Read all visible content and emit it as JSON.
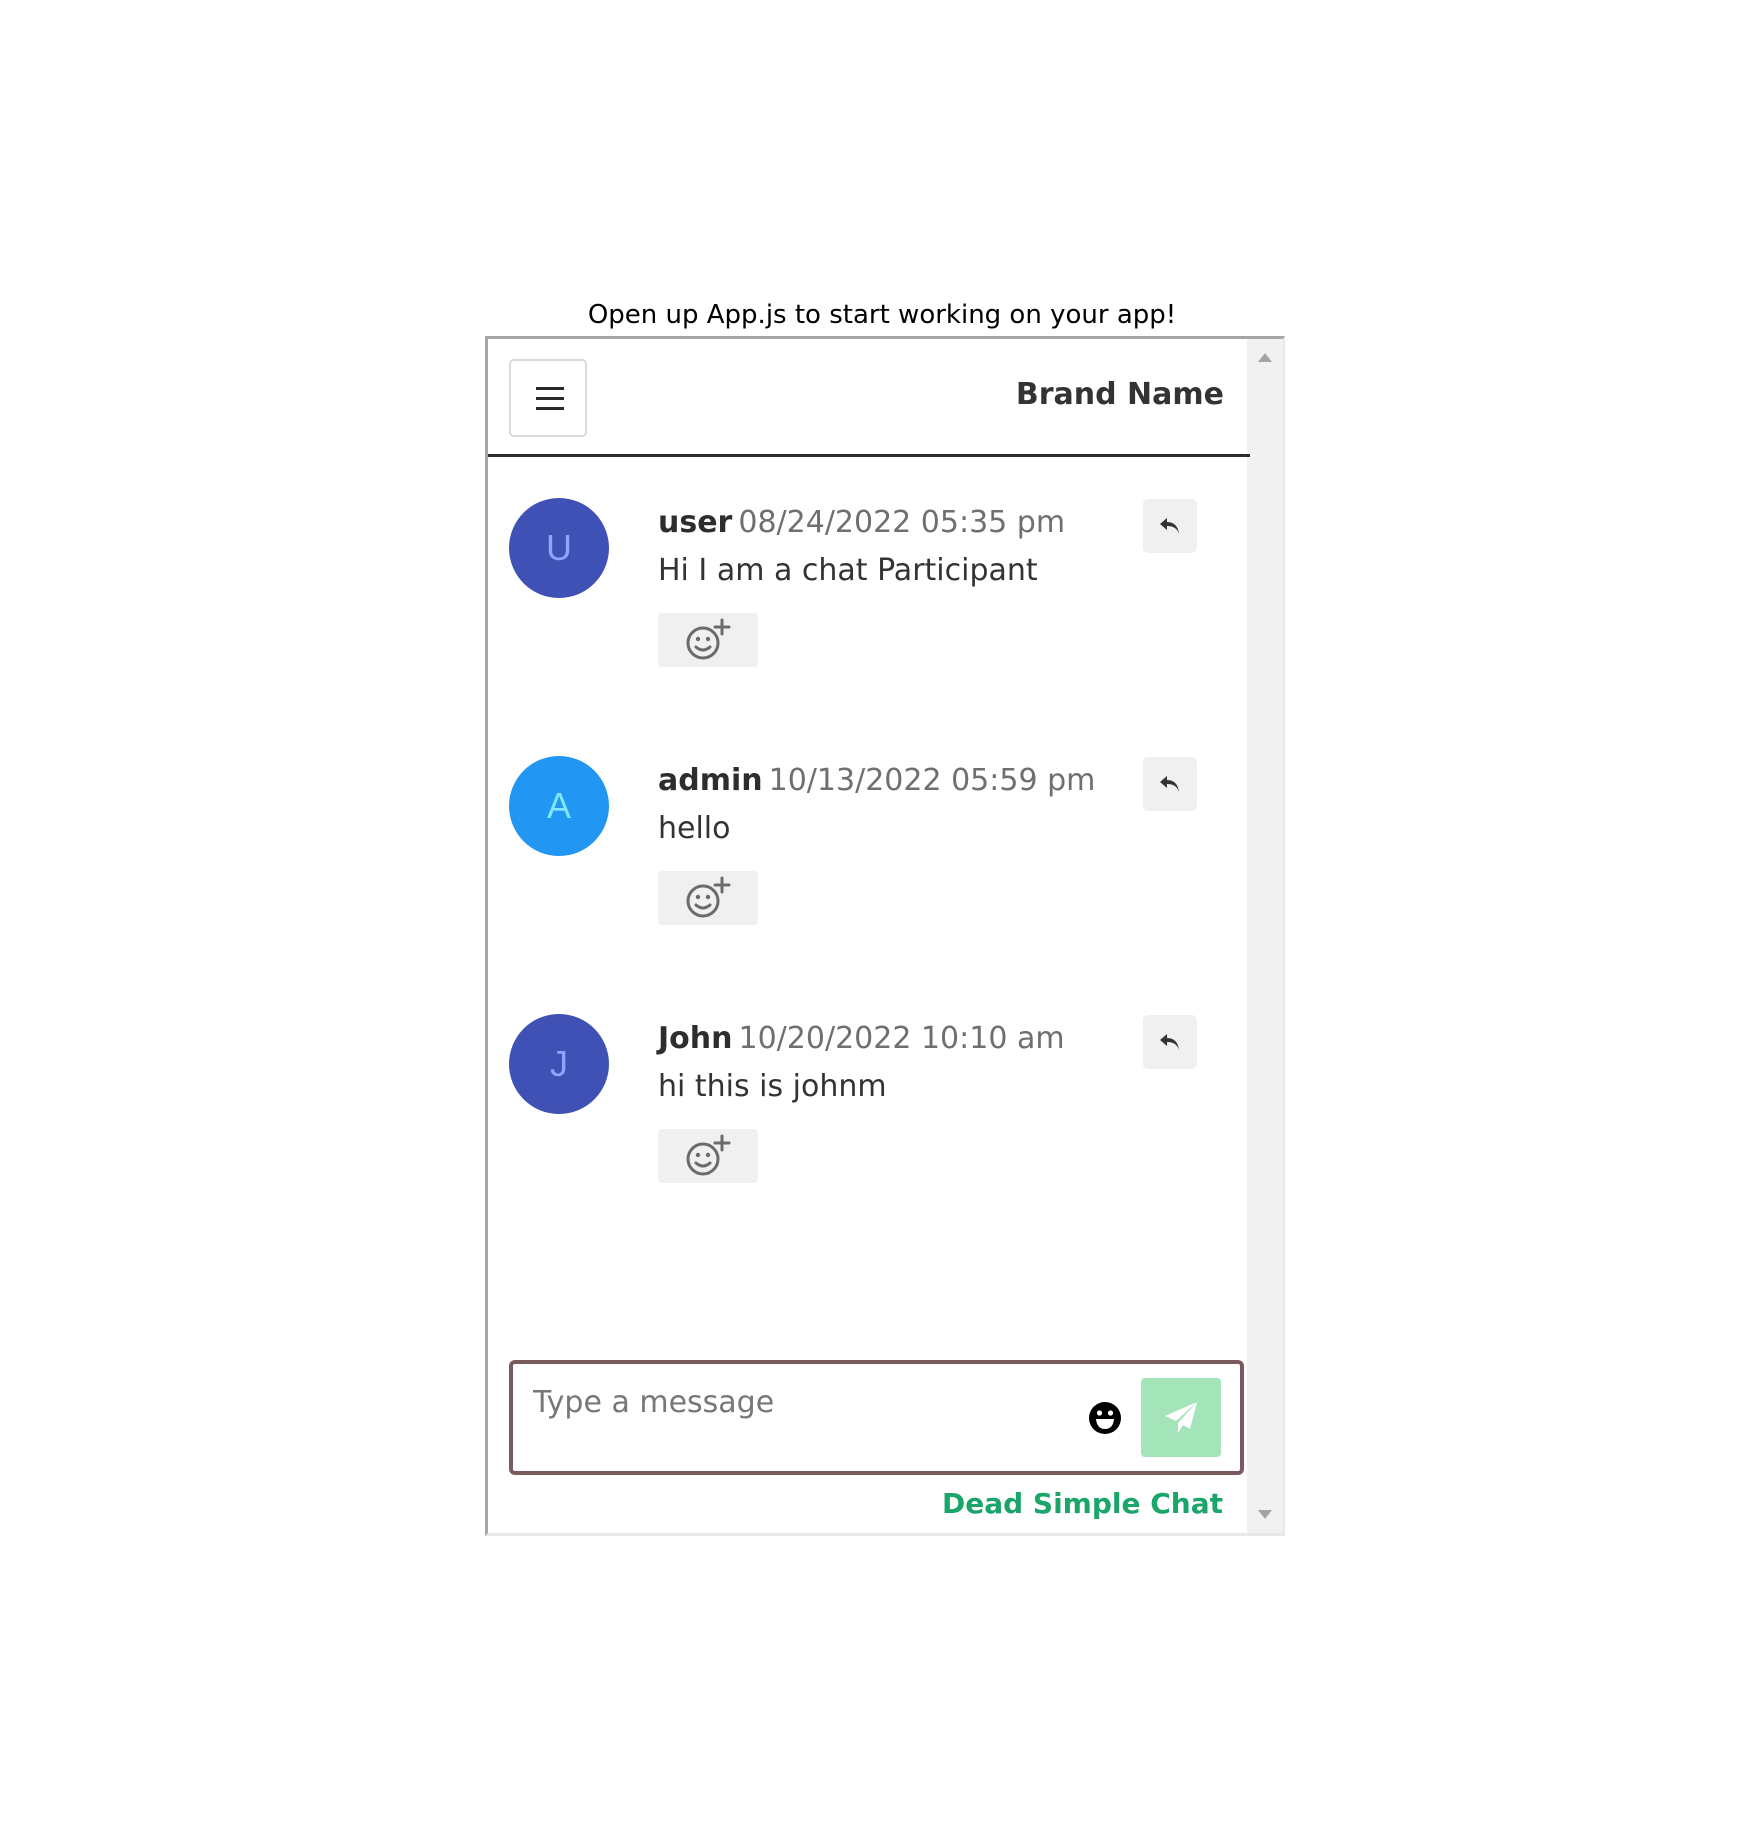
{
  "page": {
    "caption": "Open up App.js to start working on your app!"
  },
  "header": {
    "brand_name": "Brand Name",
    "menu_icon": "hamburger-menu-icon"
  },
  "messages": [
    {
      "initial": "U",
      "user": "user",
      "timestamp": "08/24/2022 05:35 pm",
      "text": "Hi I am a chat Participant",
      "avatar_bg": "#3f51b5",
      "avatar_fg": "#8fa3ff"
    },
    {
      "initial": "A",
      "user": "admin",
      "timestamp": "10/13/2022 05:59 pm",
      "text": "hello",
      "avatar_bg": "#2196f3",
      "avatar_fg": "#7fe8ff"
    },
    {
      "initial": "J",
      "user": "John",
      "timestamp": "10/20/2022 10:10 am",
      "text": "hi this is johnm",
      "avatar_bg": "#3f51b5",
      "avatar_fg": "#8fa3ff"
    }
  ],
  "composer": {
    "placeholder": "Type a message",
    "value": "",
    "emoji_icon": "grinning-face-icon",
    "send_icon": "paper-plane-icon"
  },
  "footer": {
    "brand": "Dead Simple Chat"
  },
  "colors": {
    "composer_border": "#7a5a5e",
    "send_button": "#a3e4b8",
    "footer_brand": "#1aa569"
  }
}
